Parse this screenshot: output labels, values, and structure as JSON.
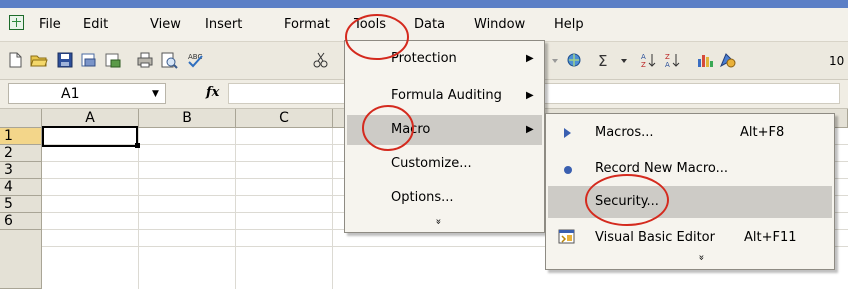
{
  "menubar": {
    "items": [
      {
        "label": "File"
      },
      {
        "label": "Edit"
      },
      {
        "label": "View"
      },
      {
        "label": "Insert"
      },
      {
        "label": "Format"
      },
      {
        "label": "Tools"
      },
      {
        "label": "Data"
      },
      {
        "label": "Window"
      },
      {
        "label": "Help"
      }
    ]
  },
  "toolbar": {
    "icons": [
      "new-icon",
      "open-icon",
      "save-icon",
      "permission-icon",
      "email-icon",
      "print-icon",
      "print-preview-icon",
      "spelling-icon",
      "cut-icon",
      "hyperlink-icon",
      "autosum-icon",
      "sort-ascending-icon",
      "sort-descending-icon",
      "chart-wizard-icon",
      "drawing-icon"
    ],
    "autosum_symbol": "Σ",
    "zoom_partial": "10"
  },
  "formula_bar": {
    "name_box_value": "A1",
    "fx_label": "fx",
    "formula_value": ""
  },
  "grid": {
    "columns": [
      "A",
      "B",
      "C"
    ],
    "rows": [
      "1",
      "2",
      "3",
      "4",
      "5",
      "6"
    ]
  },
  "tools_menu": {
    "items": [
      {
        "label": "Protection",
        "submenu": true
      },
      {
        "label": "Formula Auditing",
        "submenu": true
      },
      {
        "label": "Macro",
        "submenu": true,
        "highlighted": true
      },
      {
        "label": "Customize...",
        "submenu": false
      },
      {
        "label": "Options...",
        "submenu": false
      }
    ],
    "expand_glyph": "»"
  },
  "macro_submenu": {
    "items": [
      {
        "label": "Macros...",
        "shortcut": "Alt+F8",
        "icon": "play-icon"
      },
      {
        "label": "Record New Macro...",
        "shortcut": "",
        "icon": "record-icon"
      },
      {
        "label": "Security...",
        "shortcut": "",
        "icon": "",
        "highlighted": true
      },
      {
        "label": "Visual Basic Editor",
        "shortcut": "Alt+F11",
        "icon": "vb-editor-icon"
      }
    ],
    "expand_glyph": "»"
  },
  "colors": {
    "title_strip": "#5b7fc6",
    "annotation_red": "#d42a1e",
    "menu_highlight": "#cdcbc6"
  }
}
